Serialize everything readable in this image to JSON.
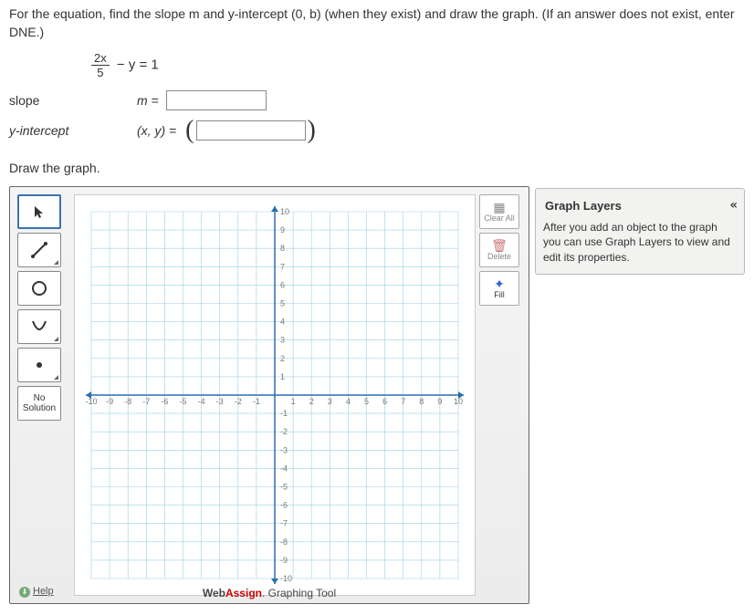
{
  "question": {
    "prompt": "For the equation, find the slope m and y-intercept (0, b) (when they exist) and draw the graph. (If an answer does not exist, enter DNE.)",
    "equation_numerator": "2x",
    "equation_denominator": "5",
    "equation_rest": " − y = 1"
  },
  "inputs": {
    "slope_label": "slope",
    "slope_var": "m  =",
    "slope_value": "",
    "yint_label": "y-intercept",
    "yint_var": "(x, y)  =",
    "yint_value": ""
  },
  "draw_heading": "Draw the graph.",
  "tools": {
    "no_solution": "No Solution",
    "help": "Help"
  },
  "right_buttons": {
    "clear_all": "Clear All",
    "delete": "Delete",
    "fill": "Fill"
  },
  "layers": {
    "title": "Graph Layers",
    "collapse": "«",
    "body": "After you add an object to the graph you can use Graph Layers to view and edit its properties."
  },
  "brand": {
    "web": "Web",
    "assign": "Assign",
    "suffix": ". Graphing Tool"
  },
  "chart_data": {
    "type": "scatter",
    "title": "",
    "xlabel": "",
    "ylabel": "",
    "xlim": [
      -10,
      10
    ],
    "ylim": [
      -10,
      10
    ],
    "xticks": [
      -10,
      -9,
      -8,
      -7,
      -6,
      -5,
      -4,
      -3,
      -2,
      -1,
      1,
      2,
      3,
      4,
      5,
      6,
      7,
      8,
      9,
      10
    ],
    "yticks": [
      -10,
      -9,
      -8,
      -7,
      -6,
      -5,
      -4,
      -3,
      -2,
      -1,
      1,
      2,
      3,
      4,
      5,
      6,
      7,
      8,
      9,
      10
    ],
    "series": []
  }
}
